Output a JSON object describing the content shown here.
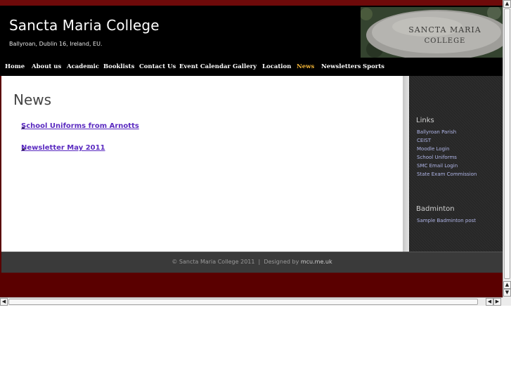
{
  "header": {
    "site_title": "Sancta Maria College",
    "tagline": "Ballyroan, Dublin 16, Ireland, EU.",
    "logo_line1": "SANCTA MARIA",
    "logo_line2": "COLLEGE"
  },
  "nav": {
    "items": [
      "Home",
      "About us",
      "Academic",
      "Booklists",
      "Contact Us",
      "Event Calendar",
      "Gallery",
      "Location",
      "News",
      "Newsletters",
      "Sports"
    ],
    "active": "News"
  },
  "main": {
    "page_title": "News",
    "news_items": [
      "School Uniforms from Arnotts",
      "Newsletter May 2011"
    ]
  },
  "sidebar": {
    "links_title": "Links",
    "links": [
      "Ballyroan Parish",
      "CEIST",
      "Moodle Login",
      "School Uniforms",
      "SMC Email Login",
      "State Exam Commission"
    ],
    "badminton_title": "Badminton",
    "badminton_links": [
      "Sample Badminton post"
    ]
  },
  "footer": {
    "text": "© Sancta Maria College 2011  |  Designed by ",
    "designer": "mcu.me.uk"
  },
  "colors": {
    "accent": "#f2b437",
    "background": "#5a0000",
    "link": "#5a2ac0",
    "sidebar_link": "#b0b6e8"
  },
  "icons": {
    "scroll_up": "arrow-up-icon",
    "scroll_down": "arrow-down-icon",
    "scroll_left": "arrow-left-icon",
    "scroll_right": "arrow-right-icon"
  }
}
